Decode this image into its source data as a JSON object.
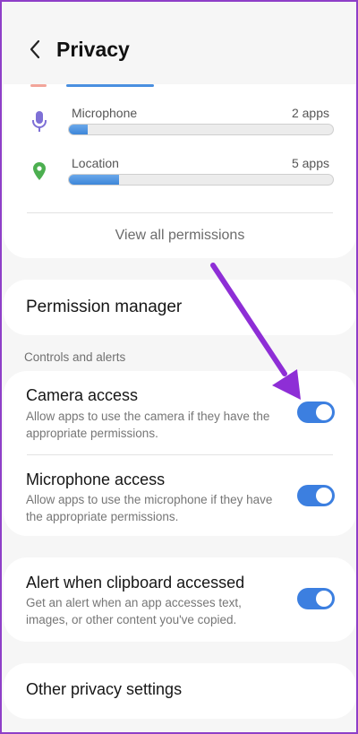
{
  "header": {
    "title": "Privacy"
  },
  "permissions": [
    {
      "label": "Microphone",
      "count": "2 apps",
      "fill": 0.07,
      "icon": "microphone-icon",
      "color": "#7e70d6"
    },
    {
      "label": "Location",
      "count": "5 apps",
      "fill": 0.19,
      "icon": "location-pin-icon",
      "color": "#4caf50"
    }
  ],
  "view_all": "View all permissions",
  "permission_manager": "Permission manager",
  "section": "Controls and alerts",
  "controls": [
    {
      "title": "Camera access",
      "desc": "Allow apps to use the camera if they have the appropriate permissions.",
      "on": true
    },
    {
      "title": "Microphone access",
      "desc": "Allow apps to use the microphone if they have the appropriate permissions.",
      "on": true
    }
  ],
  "clipboard": {
    "title": "Alert when clipboard accessed",
    "desc": "Get an alert when an app accesses text, images, or other content you've copied.",
    "on": true
  },
  "other": "Other privacy settings",
  "colors": {
    "accent": "#3c7fe0",
    "annotation_arrow": "#8e2ed6"
  }
}
